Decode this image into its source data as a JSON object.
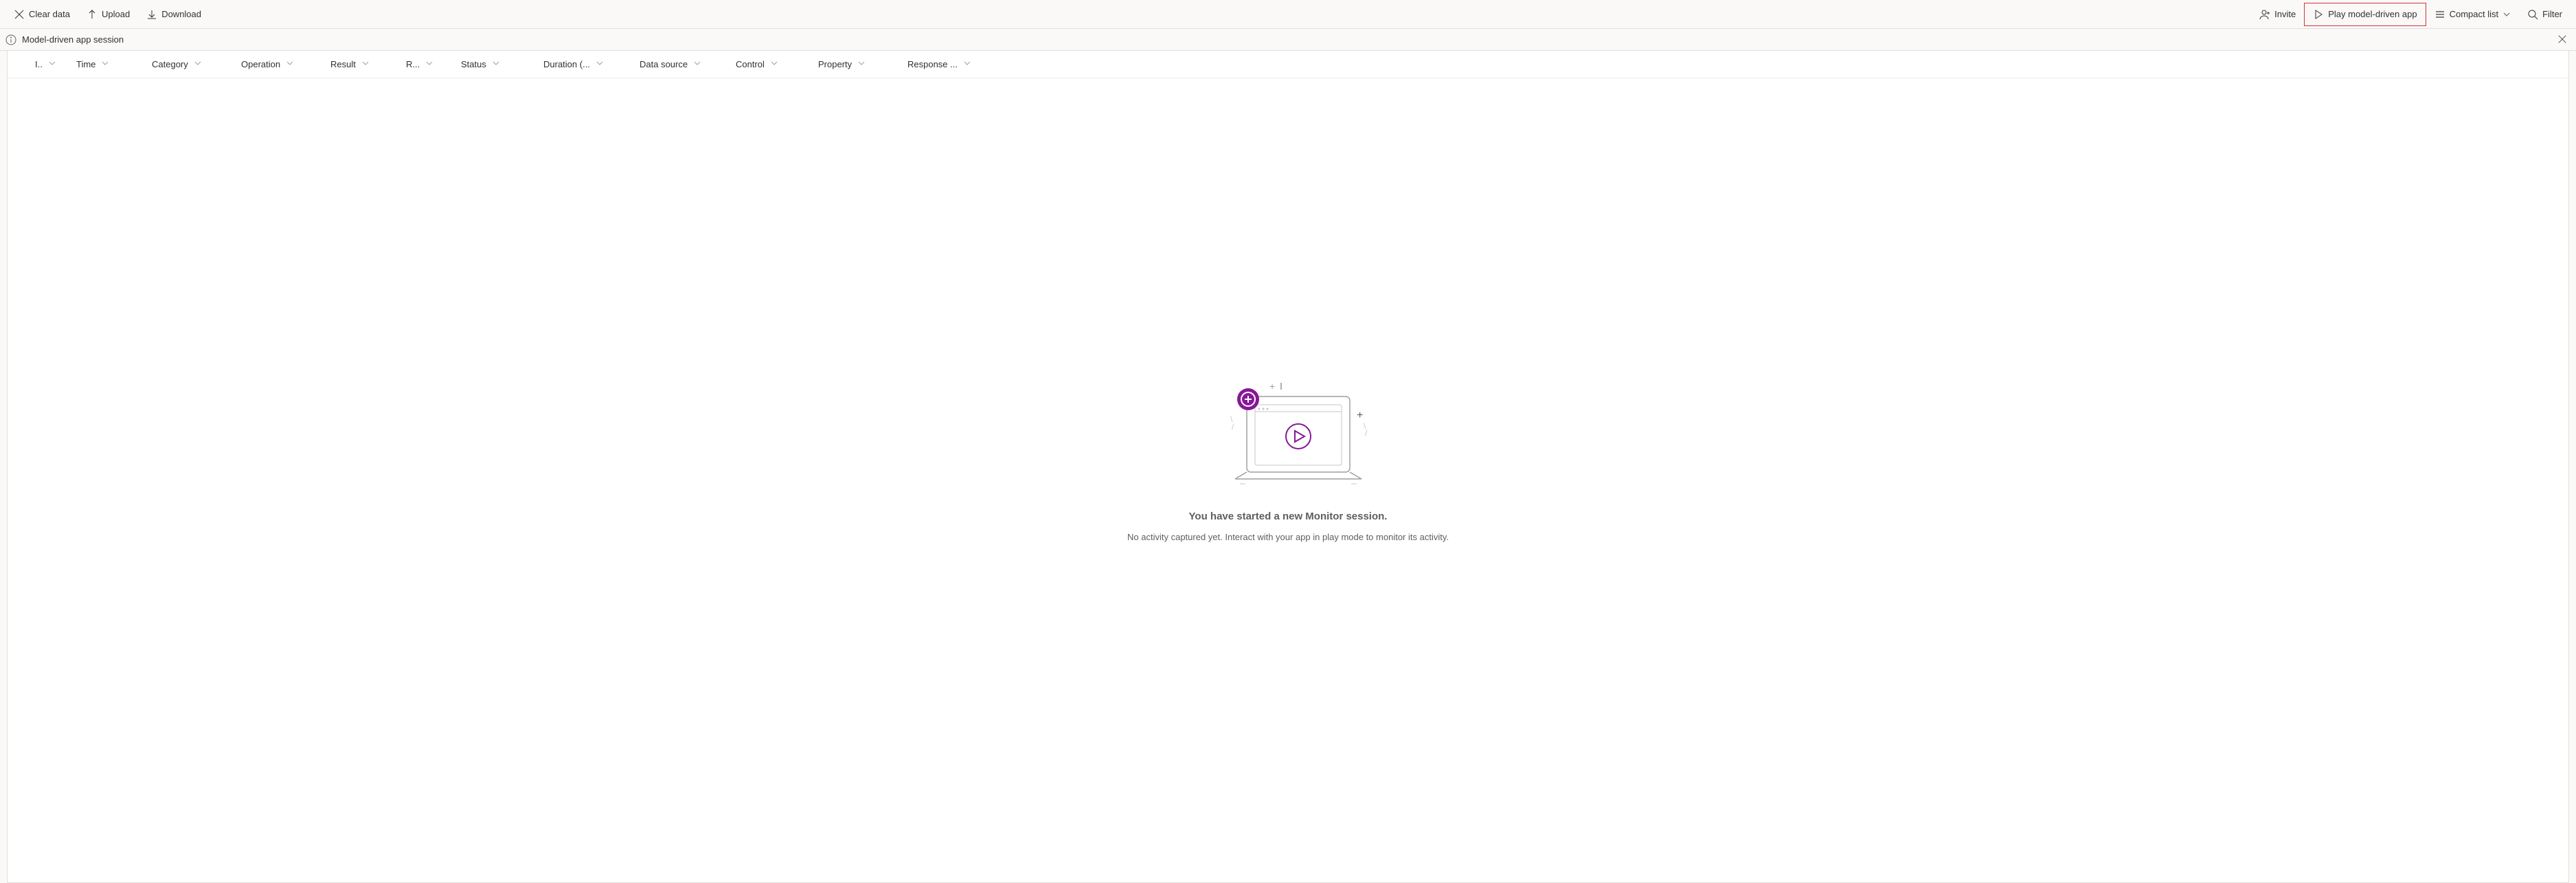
{
  "toolbar": {
    "left": {
      "clear_data": "Clear data",
      "upload": "Upload",
      "download": "Download"
    },
    "right": {
      "invite": "Invite",
      "play_app": "Play model-driven app",
      "compact_list": "Compact list",
      "filter": "Filter"
    }
  },
  "subbar": {
    "session_label": "Model-driven app session"
  },
  "columns": {
    "id": "I..",
    "time": "Time",
    "category": "Category",
    "operation": "Operation",
    "result": "Result",
    "r2": "R...",
    "status": "Status",
    "duration": "Duration (...",
    "data_source": "Data source",
    "control": "Control",
    "property": "Property",
    "response": "Response ..."
  },
  "empty": {
    "title": "You have started a new Monitor session.",
    "subtitle": "No activity captured yet. Interact with your app in play mode to monitor its activity."
  }
}
